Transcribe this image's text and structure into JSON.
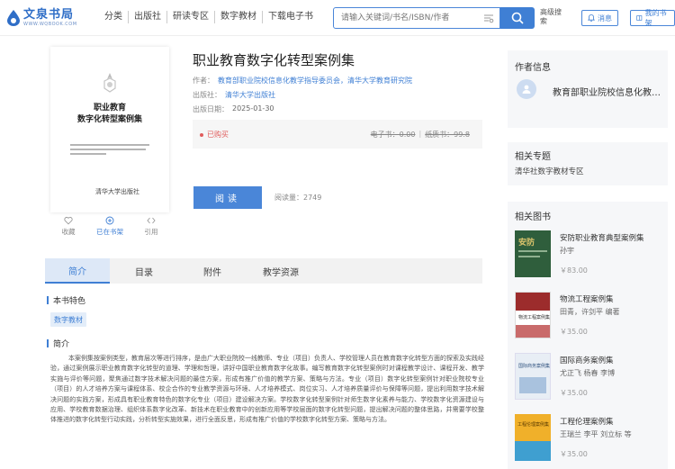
{
  "header": {
    "logo_name": "文泉书局",
    "logo_url": "WWW.WQBOOK.COM",
    "nav": [
      "分类",
      "出版社",
      "研读专区",
      "数字教材",
      "下载电子书"
    ],
    "search_placeholder": "请输入关键词/书名/ISBN/作者",
    "advanced_search": "高级搜索",
    "btn_messages": "消息",
    "btn_bookshelf": "我的书架"
  },
  "book": {
    "cover_title_line1": "职业教育",
    "cover_title_line2": "数字化转型案例集",
    "cover_publisher": "清华大学出版社",
    "title": "职业教育数字化转型案例集",
    "author_label": "作者：",
    "author_value": "教育部职业院校信息化教学指导委员会，清华大学教育研究院",
    "publisher_label": "出版社：",
    "publisher_value": "清华大学出版社",
    "date_label": "出版日期：",
    "date_value": "2025-01-30",
    "owned": "已购买",
    "price_ebook": "电子书：0.00",
    "price_paper": "纸质书：99.8",
    "read_button": "阅读",
    "read_count": "阅读量：2749",
    "actions": {
      "favorite": "收藏",
      "bookshelf": "已在书架",
      "cite": "引用"
    }
  },
  "tabs": [
    "简介",
    "目录",
    "附件",
    "教学资源"
  ],
  "features": {
    "heading": "本书特色",
    "tag": "数字教材"
  },
  "intro": {
    "heading": "简介",
    "text": "本案例集按案例类型，教育层次等进行排序，是由广大职业院校一线教师、专业（项目）负责人、学校管理人员在教育数字化转型方面的探索及实践经验，通过案例展示职业教育数字化转型的道理、学理和哲理，讲好中国职业教育数字化故事。编写教育数字化转型案例时对课程教学设计、课程开发、教学实施与评价等问题，聚焦通过数字技术解决问题的最佳方案，形成有推广价值的教学方案、策略与方法。专业（项目）数字化转型案例针对职业院校专业（项目）的人才培养方案与课程体系、校企合作的专业教学资源与环境、人才培养模式、岗位实习、人才培养质量评价与保障等问题，提出利用数字技术解决问题的实践方案，形成具有职业教育特色的数字化专业（项目）建设解决方案。学校数字化转型案例针对师生数字化素养与能力、学校数字化资源建设与应用、学校教育数据治理、组织体系数字化改革、新技术在职业教育中的创新应用等学校层面的数字化转型问题，提出解决问题的整体思路，并需要学校整体推进的数字化转型行动实践，分析转型实施效果，进行全面反思，形成有推广价值的学校数字化转型方案、策略与方法。"
  },
  "sidebar": {
    "author_heading": "作者信息",
    "author_name": "教育部职业院校信息化教学指导委员会",
    "topic_heading": "相关专题",
    "topic_link": "清华社数字教材专区",
    "related_heading": "相关图书",
    "related": [
      {
        "title": "安防职业教育典型案例集",
        "author": "孙宇",
        "price": "￥83.00",
        "cover_color": "#2f5e3c",
        "cover_text": "安防"
      },
      {
        "title": "物流工程案例集",
        "author": "田青，许剑平 编著",
        "price": "￥35.00",
        "cover_color": "#9c2c2c",
        "cover_text": "物流工程案例集"
      },
      {
        "title": "国际商务案例集",
        "author": "尤正飞 杨春 李博",
        "price": "￥35.00",
        "cover_color": "#e8eef5",
        "cover_text": "国际商务案例集"
      },
      {
        "title": "工程伦理案例集",
        "author": "王瑞兰 李平 刘立标 等",
        "price": "￥35.00",
        "cover_color": "#f0b02a",
        "cover_text": "工程伦理案例集"
      }
    ]
  }
}
